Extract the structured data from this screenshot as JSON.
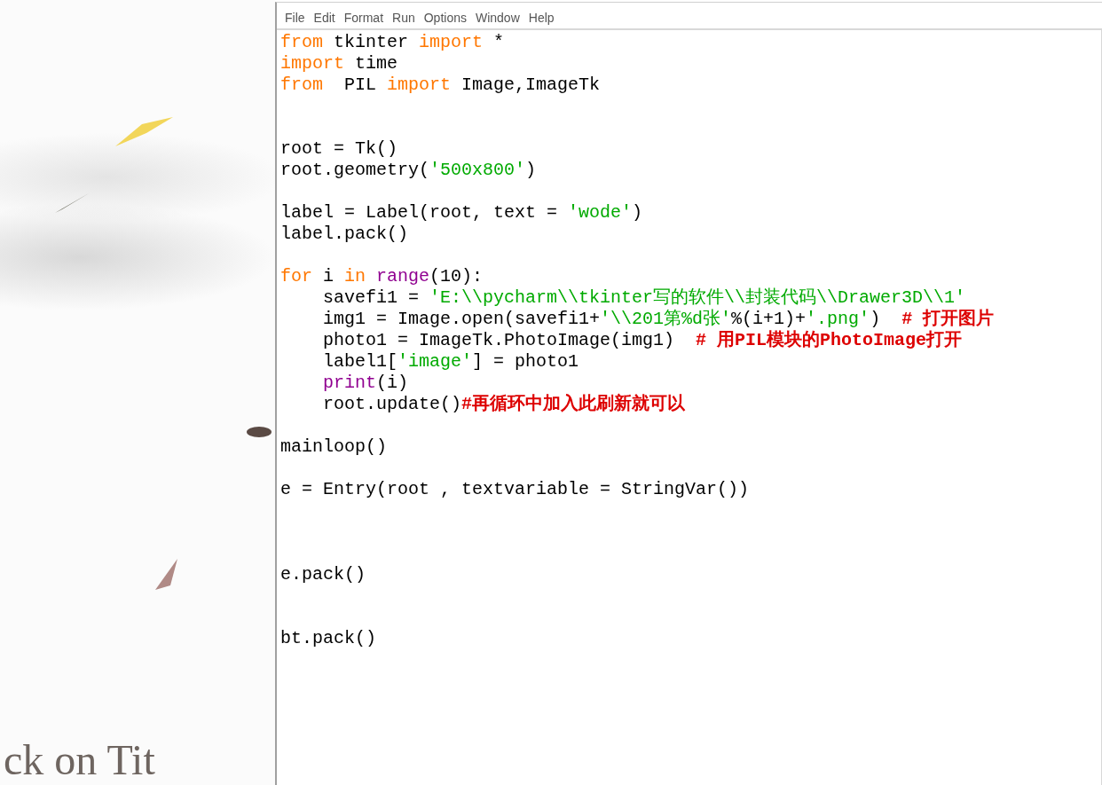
{
  "backdrop": {
    "caption": "ck on Tit"
  },
  "menu": [
    "File",
    "Edit",
    "Format",
    "Run",
    "Options",
    "Window",
    "Help"
  ],
  "code": [
    {
      "kind": "code",
      "segments": [
        {
          "kind": "keyword",
          "text": "from"
        },
        {
          "kind": "plain",
          "text": " tkinter "
        },
        {
          "kind": "keyword",
          "text": "import"
        },
        {
          "kind": "plain",
          "text": " *"
        }
      ]
    },
    {
      "kind": "code",
      "segments": [
        {
          "kind": "keyword",
          "text": "import"
        },
        {
          "kind": "plain",
          "text": " time"
        }
      ]
    },
    {
      "kind": "code",
      "segments": [
        {
          "kind": "keyword",
          "text": "from"
        },
        {
          "kind": "plain",
          "text": "  PIL "
        },
        {
          "kind": "keyword",
          "text": "import"
        },
        {
          "kind": "plain",
          "text": " Image,ImageTk"
        }
      ]
    },
    {
      "kind": "blank"
    },
    {
      "kind": "blank"
    },
    {
      "kind": "code",
      "segments": [
        {
          "kind": "plain",
          "text": "root = Tk()"
        }
      ]
    },
    {
      "kind": "code",
      "segments": [
        {
          "kind": "plain",
          "text": "root.geometry("
        },
        {
          "kind": "string",
          "text": "'500x800'"
        },
        {
          "kind": "plain",
          "text": ")"
        }
      ]
    },
    {
      "kind": "blank"
    },
    {
      "kind": "code",
      "segments": [
        {
          "kind": "plain",
          "text": "label = Label(root, text = "
        },
        {
          "kind": "string",
          "text": "'wode'"
        },
        {
          "kind": "plain",
          "text": ")"
        }
      ]
    },
    {
      "kind": "code",
      "segments": [
        {
          "kind": "plain",
          "text": "label.pack()"
        }
      ]
    },
    {
      "kind": "blank"
    },
    {
      "kind": "code",
      "segments": [
        {
          "kind": "keyword",
          "text": "for"
        },
        {
          "kind": "plain",
          "text": " i "
        },
        {
          "kind": "keyword",
          "text": "in"
        },
        {
          "kind": "builtin",
          "text": " range"
        },
        {
          "kind": "plain",
          "text": "(10):"
        }
      ]
    },
    {
      "kind": "code",
      "segments": [
        {
          "kind": "plain",
          "text": "    savefi1 = "
        },
        {
          "kind": "string",
          "text": "'E:\\\\pycharm\\\\tkinter写的软件\\\\封装代码\\\\Drawer3D\\\\1'"
        }
      ]
    },
    {
      "kind": "code",
      "segments": [
        {
          "kind": "plain",
          "text": "    img1 = Image.open(savefi1+"
        },
        {
          "kind": "string",
          "text": "'\\\\201第%d张'"
        },
        {
          "kind": "plain",
          "text": "%(i+1)+"
        },
        {
          "kind": "string",
          "text": "'.png'"
        },
        {
          "kind": "plain",
          "text": ")  "
        },
        {
          "kind": "comment",
          "text": "# 打开图片"
        }
      ]
    },
    {
      "kind": "code",
      "segments": [
        {
          "kind": "plain",
          "text": "    photo1 = ImageTk.PhotoImage(img1)  "
        },
        {
          "kind": "comment",
          "text": "# 用PIL模块的PhotoImage打开"
        }
      ]
    },
    {
      "kind": "code",
      "segments": [
        {
          "kind": "plain",
          "text": "    label1["
        },
        {
          "kind": "string",
          "text": "'image'"
        },
        {
          "kind": "plain",
          "text": "] = photo1"
        }
      ]
    },
    {
      "kind": "code",
      "segments": [
        {
          "kind": "builtin",
          "text": "    print"
        },
        {
          "kind": "plain",
          "text": "(i)"
        }
      ]
    },
    {
      "kind": "code",
      "segments": [
        {
          "kind": "plain",
          "text": "    root.update()"
        },
        {
          "kind": "comment",
          "text": "#再循环中加入此刷新就可以"
        }
      ]
    },
    {
      "kind": "blank"
    },
    {
      "kind": "code",
      "segments": [
        {
          "kind": "plain",
          "text": "mainloop()"
        }
      ]
    },
    {
      "kind": "blank"
    },
    {
      "kind": "code",
      "segments": [
        {
          "kind": "plain",
          "text": "e = Entry(root , textvariable = StringVar())"
        }
      ]
    },
    {
      "kind": "blank"
    },
    {
      "kind": "blank"
    },
    {
      "kind": "blank"
    },
    {
      "kind": "code",
      "segments": [
        {
          "kind": "plain",
          "text": "e.pack()"
        }
      ]
    },
    {
      "kind": "blank"
    },
    {
      "kind": "blank"
    },
    {
      "kind": "code",
      "segments": [
        {
          "kind": "plain",
          "text": "bt.pack()"
        }
      ]
    }
  ]
}
